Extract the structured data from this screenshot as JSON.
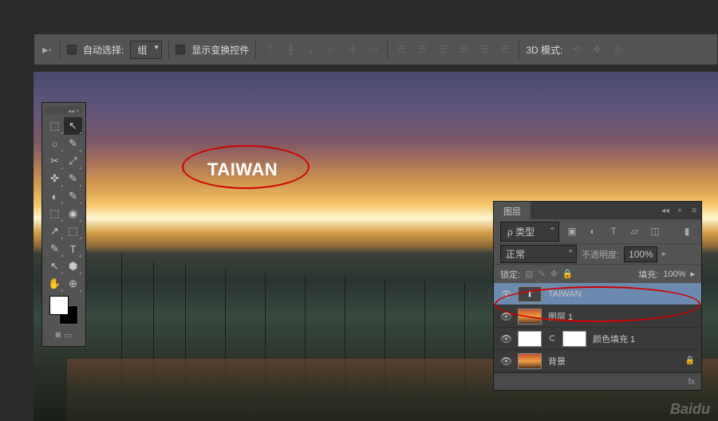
{
  "options_bar": {
    "auto_select_label": "自动选择:",
    "auto_select_mode": "组",
    "show_transform_label": "显示变换控件",
    "three_d_label": "3D 模式:"
  },
  "canvas": {
    "text_content": "TAIWAN"
  },
  "tools": {
    "icons": [
      "⬚",
      "↖",
      "○",
      "✎",
      "✂",
      "⤢",
      "✜",
      "✎",
      "◐",
      "✎",
      "⬚",
      "◉",
      "↗",
      "⬚",
      "✎",
      "T",
      "↖",
      "⬢",
      "✋",
      "⊕"
    ]
  },
  "layers_panel": {
    "tab_label": "图层",
    "kind_filter": "ρ 类型",
    "blend_mode": "正常",
    "opacity_label": "不透明度:",
    "opacity_value": "100%",
    "lock_label": "锁定:",
    "fill_label": "填充:",
    "fill_value": "100%",
    "footer_fx": "fx",
    "layers": [
      {
        "name": "TAIWAN",
        "type": "text",
        "visible": true,
        "selected": true,
        "locked": false
      },
      {
        "name": "图层 1",
        "type": "image",
        "visible": true,
        "selected": false,
        "locked": false
      },
      {
        "name": "颜色填充 1",
        "type": "fill",
        "visible": true,
        "selected": false,
        "locked": false
      },
      {
        "name": "背景",
        "type": "bg",
        "visible": true,
        "selected": false,
        "locked": true
      }
    ]
  }
}
